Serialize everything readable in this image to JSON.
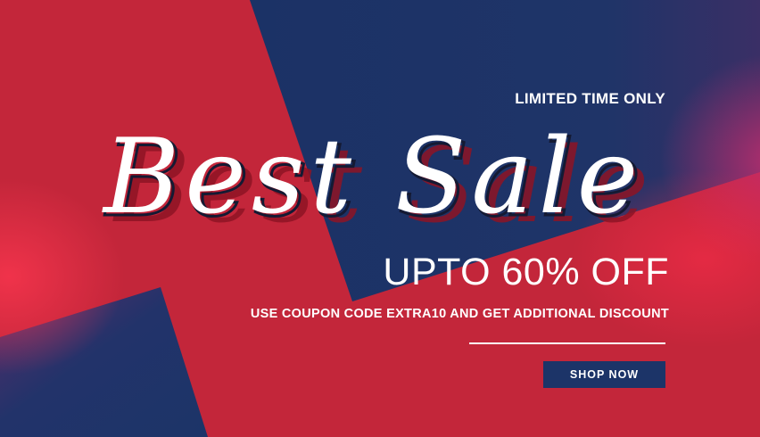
{
  "banner": {
    "eyebrow": "LIMITED TIME ONLY",
    "script_title": "Best Sale",
    "headline": "UPTO 60% OFF",
    "subline": "USE COUPON CODE EXTRA10 AND GET ADDITIONAL DISCOUNT",
    "cta_label": "SHOP NOW"
  },
  "colors": {
    "background_red": "#c3263a",
    "navy": "#1c3468",
    "text": "#ffffff",
    "script_shadow": "#8e1424"
  }
}
